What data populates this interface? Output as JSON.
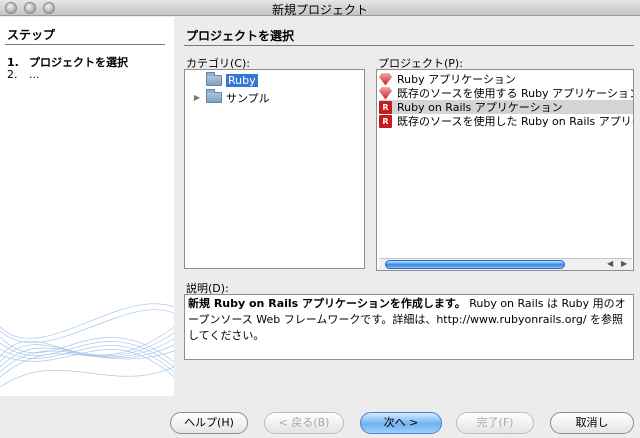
{
  "window": {
    "title": "新規プロジェクト"
  },
  "steps": {
    "header": "ステップ",
    "items": [
      {
        "num": "1.",
        "label": "プロジェクトを選択"
      },
      {
        "num": "2.",
        "label": "..."
      }
    ]
  },
  "main": {
    "header": "プロジェクトを選択"
  },
  "categories": {
    "label": "カテゴリ(C):",
    "items": [
      {
        "label": "Ruby",
        "selected": true,
        "icon": "folder-icon"
      },
      {
        "label": "サンプル",
        "expandable": true,
        "icon": "folder-icon"
      }
    ]
  },
  "projects": {
    "label": "プロジェクト(P):",
    "items": [
      {
        "label": "Ruby アプリケーション",
        "icon": "ruby-icon"
      },
      {
        "label": "既存のソースを使用する Ruby アプリケーション",
        "icon": "ruby-icon"
      },
      {
        "label": "Ruby on Rails アプリケーション",
        "icon": "rails-icon",
        "selected": true
      },
      {
        "label": "既存のソースを使用した Ruby on Rails アプリケーション",
        "icon": "rails-icon"
      }
    ]
  },
  "description": {
    "label": "説明(D):",
    "bold": "新規 Ruby on Rails アプリケーションを作成します。",
    "text": " Ruby on Rails は Ruby 用のオープンソース Web フレームワークです。詳細は、http://www.rubyonrails.org/ を参照してください。"
  },
  "buttons": {
    "help": "ヘルプ(H)",
    "back": "< 戻る(B)",
    "next": "次へ >",
    "finish": "完了(F)",
    "cancel": "取消し"
  }
}
